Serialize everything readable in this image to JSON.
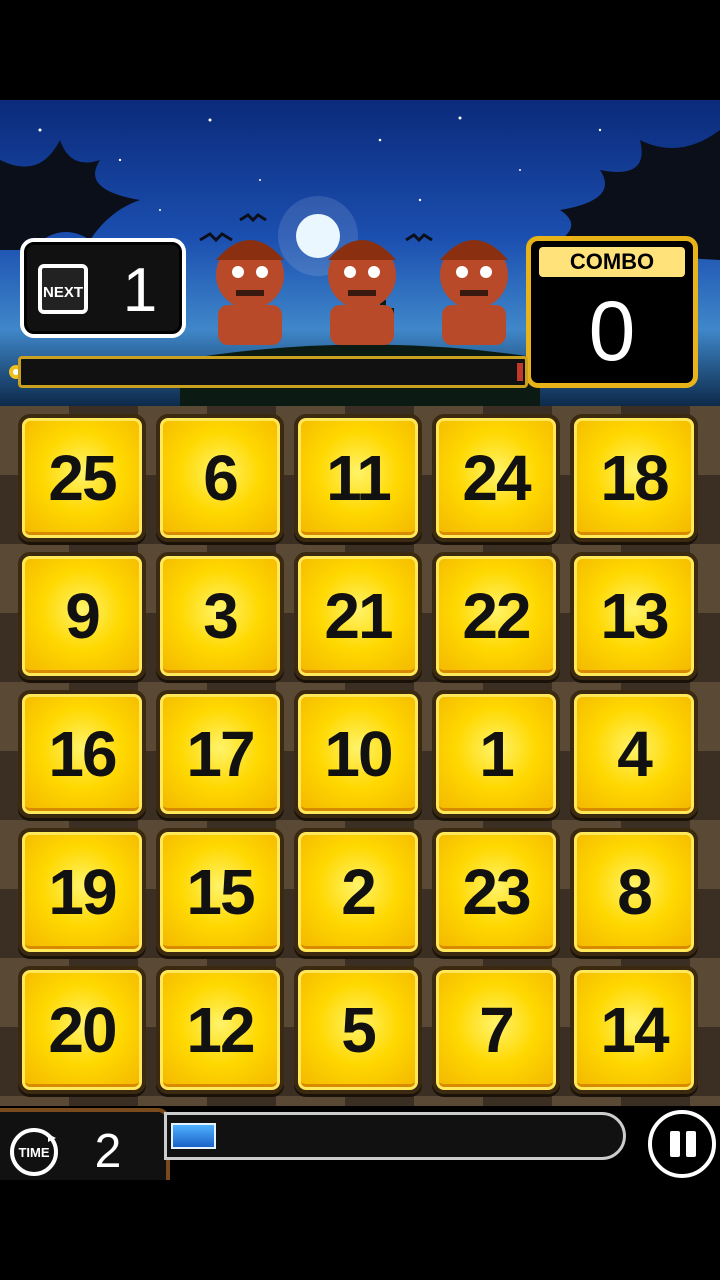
{
  "hud": {
    "next_label": "NEXT",
    "next_value": "1",
    "combo_label": "COMBO",
    "combo_value": "0"
  },
  "board": {
    "rows": [
      [
        "25",
        "6",
        "11",
        "24",
        "18"
      ],
      [
        "9",
        "3",
        "21",
        "22",
        "13"
      ],
      [
        "16",
        "17",
        "10",
        "1",
        "4"
      ],
      [
        "19",
        "15",
        "2",
        "23",
        "8"
      ],
      [
        "20",
        "12",
        "5",
        "7",
        "14"
      ]
    ]
  },
  "footer": {
    "time_label": "TIME",
    "time_value": "2",
    "time_progress": 0.1,
    "pause_icon": "pause-icon"
  },
  "colors": {
    "tile": "#ffd800",
    "combo_border": "#e7b318",
    "time_fill": "#2f86e6"
  }
}
